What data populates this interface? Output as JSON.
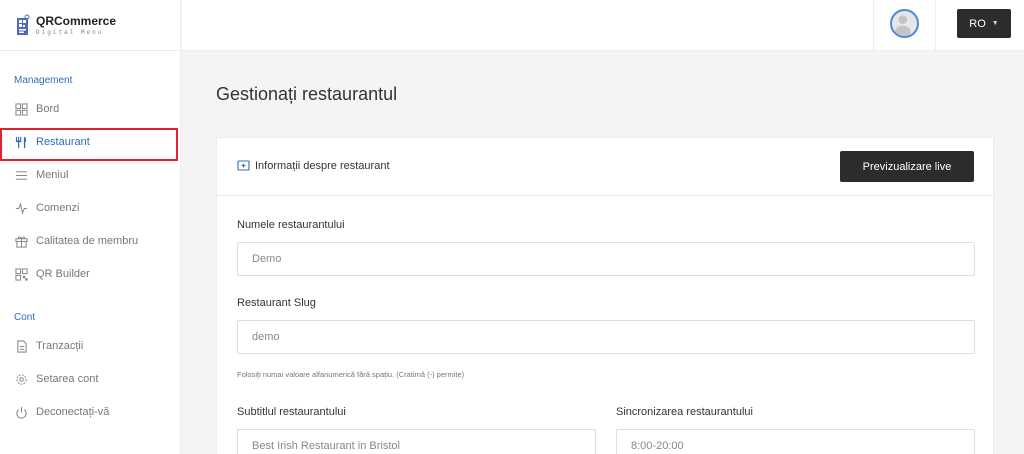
{
  "brand": {
    "name": "QRCommerce",
    "subtitle": "Digital Menu"
  },
  "sidebar": {
    "sections": [
      {
        "label": "Management"
      },
      {
        "label": "Cont"
      }
    ],
    "items": [
      {
        "label": "Bord",
        "icon": "dashboard-grid-icon"
      },
      {
        "label": "Restaurant",
        "icon": "fork-knife-icon",
        "active": true
      },
      {
        "label": "Meniul",
        "icon": "menu-lines-icon"
      },
      {
        "label": "Comenzi",
        "icon": "activity-icon"
      },
      {
        "label": "Calitatea de membru",
        "icon": "gift-icon"
      },
      {
        "label": "QR Builder",
        "icon": "qr-icon"
      },
      {
        "label": "Tranzacții",
        "icon": "document-icon"
      },
      {
        "label": "Setarea cont",
        "icon": "gear-icon"
      },
      {
        "label": "Deconectați-vă",
        "icon": "power-icon"
      }
    ]
  },
  "header": {
    "language": "RO"
  },
  "main": {
    "title": "Gestionați restaurantul",
    "card": {
      "title": "Informații despre restaurant",
      "preview_button": "Previzualizare live",
      "fields": {
        "name": {
          "label": "Numele restaurantului",
          "value": "Demo"
        },
        "slug": {
          "label": "Restaurant Slug",
          "value": "demo",
          "hint": "Folosiți numai valoare alfanumerică fără spațiu. (Cratimă (-) permite)"
        },
        "subtitle": {
          "label": "Subtitlul restaurantului",
          "value": "Best Irish Restaurant in Bristol"
        },
        "timing": {
          "label": "Sincronizarea restaurantului",
          "value": "8:00-20:00"
        }
      }
    }
  },
  "colors": {
    "accent": "#2d6db5",
    "highlight": "#e0212f",
    "dark_button": "#2c2c2c"
  }
}
